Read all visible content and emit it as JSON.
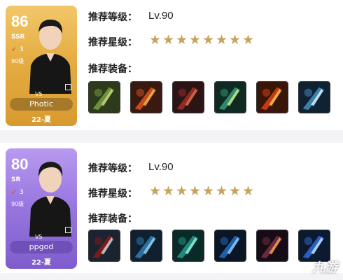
{
  "cards": [
    {
      "rating": "86",
      "rarity": "SSR",
      "flame_count": "3",
      "level": "90级",
      "team": "V5",
      "name": "Photic",
      "season": "22-夏",
      "theme": "gold",
      "info": {
        "level_label": "推荐等级：",
        "level_value": "Lv.90",
        "stars_label": "推荐星级：",
        "stars": 8,
        "equip_label": "推荐装备："
      },
      "equipment": [
        "bow-icon",
        "arrow-icon",
        "red-armor-icon",
        "green-sword-icon",
        "fire-blade-icon",
        "ice-spear-icon"
      ]
    },
    {
      "rating": "80",
      "rarity": "SR",
      "flame_count": "3",
      "level": "90级",
      "team": "V5",
      "name": "ppgod",
      "season": "22-夏",
      "theme": "purple",
      "info": {
        "level_label": "推荐等级：",
        "level_value": "Lv.90",
        "stars_label": "推荐星级：",
        "stars": 8,
        "equip_label": "推荐装备："
      },
      "equipment": [
        "shield-helm-icon",
        "scale-armor-icon",
        "green-cloak-icon",
        "blue-ring-icon",
        "dark-blade-icon",
        "blue-crystal-icon"
      ]
    }
  ],
  "watermark": "九游",
  "colors": {
    "star": "#c7a35d",
    "gold_card": "#e5ad43",
    "purple_card": "#9a78e0"
  }
}
